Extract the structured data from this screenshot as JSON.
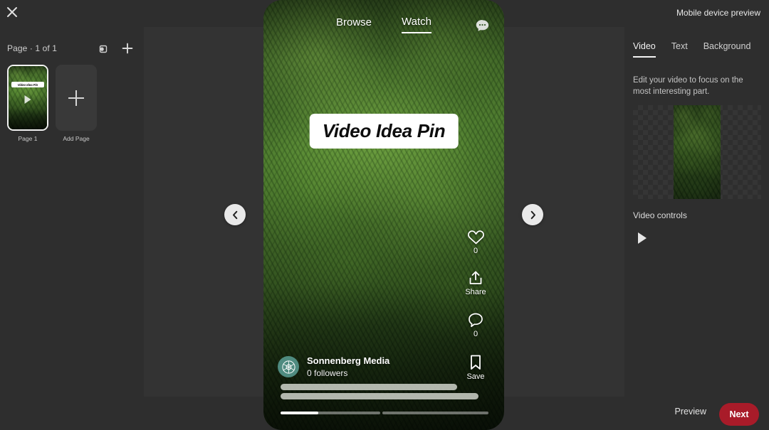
{
  "topbar": {
    "close_icon": "close-icon"
  },
  "sidebar": {
    "page_counter": "Page · 1 of 1",
    "duplicate_icon": "duplicate-icon",
    "add_icon": "plus-icon",
    "pages": [
      {
        "label": "Page 1",
        "caption": "Video Idea Pin"
      }
    ],
    "add_page_label": "Add Page"
  },
  "phone": {
    "tabs": [
      {
        "label": "Browse",
        "active": false
      },
      {
        "label": "Watch",
        "active": true
      }
    ],
    "chat_icon": "chat-bubble-icon",
    "headline": "Video Idea Pin",
    "rail": [
      {
        "icon": "heart-icon",
        "label": "0"
      },
      {
        "icon": "share-icon",
        "label": "Share"
      },
      {
        "icon": "comment-icon",
        "label": "0"
      },
      {
        "icon": "bookmark-icon",
        "label": "Save"
      }
    ],
    "profile": {
      "avatar_icon": "brand-avatar-icon",
      "name": "Sonnenberg Media",
      "followers": "0 followers"
    },
    "nav_prev_icon": "chevron-left-icon",
    "nav_next_icon": "chevron-right-icon"
  },
  "right_panel": {
    "header": "Mobile device preview",
    "tabs": [
      {
        "label": "Video",
        "active": true
      },
      {
        "label": "Text",
        "active": false
      },
      {
        "label": "Background",
        "active": false
      }
    ],
    "description": "Edit your video to focus on the most interesting part.",
    "video_controls_label": "Video controls",
    "play_icon": "play-icon"
  },
  "footer": {
    "preview_label": "Preview",
    "next_label": "Next"
  },
  "colors": {
    "app_background": "#2e2e2e",
    "canvas": "#333333",
    "accent_next": "#a81b29",
    "avatar": "#4f8b80"
  }
}
